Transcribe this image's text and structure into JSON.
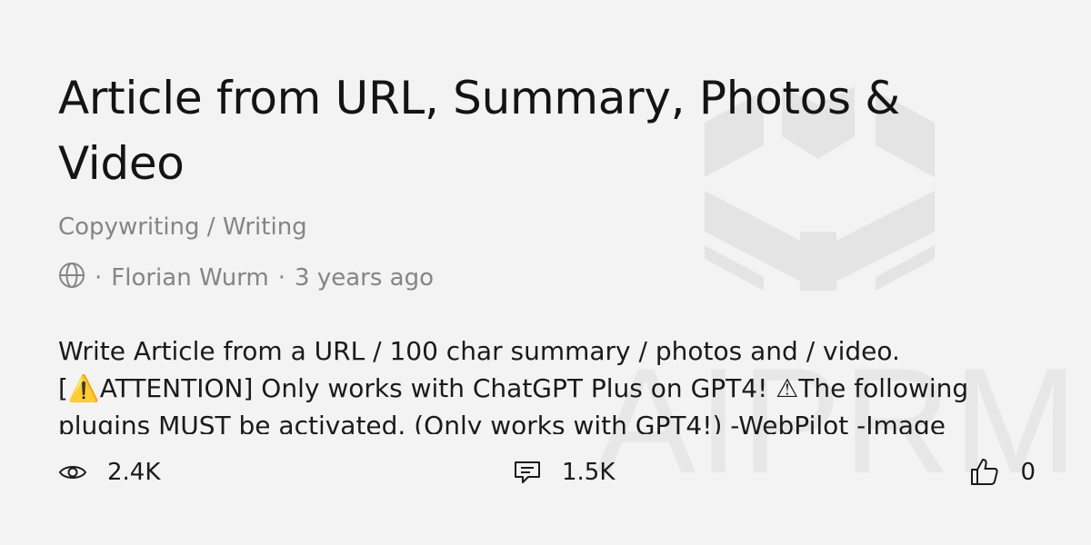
{
  "card": {
    "title": "Article from URL, Summary, Photos & Video",
    "category": "Copywriting / Writing",
    "author": "Florian Wurm",
    "time_ago": "3 years ago",
    "separator": "·",
    "visibility_icon": "globe-icon",
    "description": "Write Article from a URL / 100 char summary / photos and / video. [⚠️ATTENTION] Only works with ChatGPT Plus on GPT4! ⚠The following plugins MUST be activated. (Only works with GPT4!) -WebPilot -Image"
  },
  "stats": {
    "views": "2.4K",
    "comments": "1.5K",
    "likes": "0",
    "views_icon": "eye-icon",
    "comments_icon": "comment-icon",
    "likes_icon": "thumbs-up-icon"
  },
  "watermark": {
    "text": "AIPRM",
    "color": "#e2e2e2"
  }
}
